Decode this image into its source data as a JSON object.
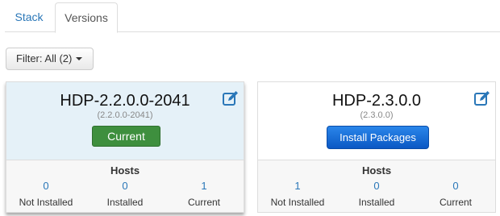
{
  "tabs": [
    {
      "label": "Stack"
    },
    {
      "label": "Versions"
    }
  ],
  "filter": {
    "label": "Filter: All (2)"
  },
  "colors": {
    "link": "#2a77b8",
    "current_btn": "#3e8f3e",
    "install_btn": "#1a6fd8",
    "selected_card": "#e5f1f8"
  },
  "icons": {
    "edit": "edit-pencil-icon",
    "dropdown": "caret-down-icon"
  },
  "versions": [
    {
      "name": "HDP-2.2.0.0-2041",
      "sub": "(2.2.0.0-2041)",
      "action": "Current",
      "hosts_title": "Hosts",
      "hosts": [
        {
          "count": "0",
          "label": "Not Installed"
        },
        {
          "count": "0",
          "label": "Installed"
        },
        {
          "count": "1",
          "label": "Current"
        }
      ]
    },
    {
      "name": "HDP-2.3.0.0",
      "sub": "(2.3.0.0)",
      "action": "Install Packages",
      "hosts_title": "Hosts",
      "hosts": [
        {
          "count": "1",
          "label": "Not Installed"
        },
        {
          "count": "0",
          "label": "Installed"
        },
        {
          "count": "0",
          "label": "Current"
        }
      ]
    }
  ]
}
